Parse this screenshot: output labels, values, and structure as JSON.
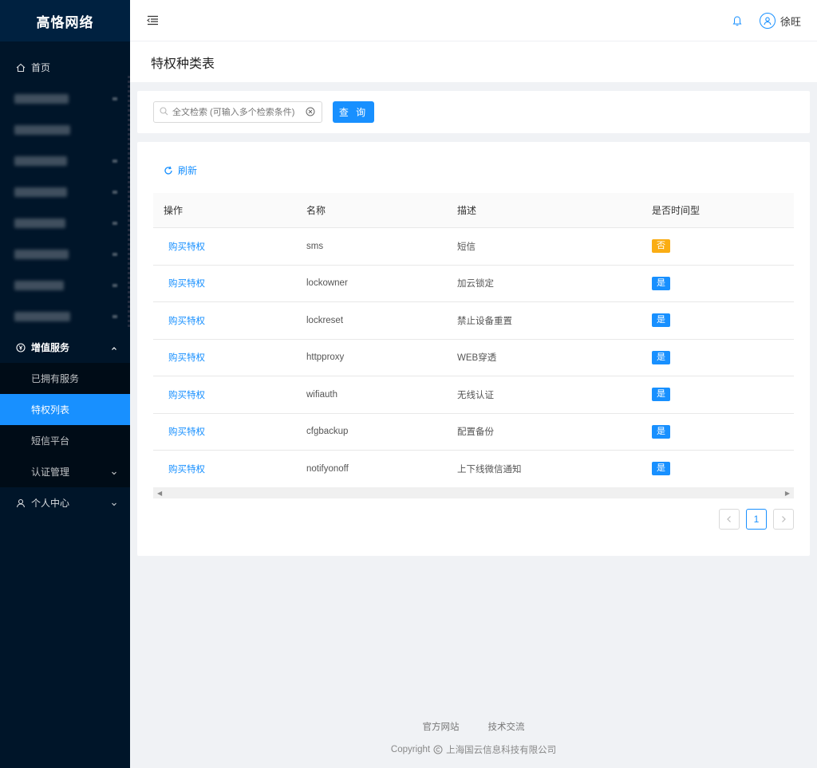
{
  "sidebar": {
    "brand": "高恪网络",
    "home": "首页",
    "value_added": "增值服务",
    "sub_items": {
      "owned": "已拥有服务",
      "privilege_list": "特权列表",
      "sms_platform": "短信平台",
      "auth_mgmt": "认证管理"
    },
    "personal": "个人中心"
  },
  "header": {
    "username": "徐旺"
  },
  "page": {
    "title": "特权种类表"
  },
  "search": {
    "placeholder": "全文检索 (可输入多个检索条件)",
    "button": "查 询"
  },
  "table": {
    "refresh": "刷新",
    "columns": [
      "操作",
      "名称",
      "描述",
      "是否时间型"
    ],
    "rows": [
      {
        "action": "购买特权",
        "name": "sms",
        "desc": "短信",
        "timed": "否"
      },
      {
        "action": "购买特权",
        "name": "lockowner",
        "desc": "加云锁定",
        "timed": "是"
      },
      {
        "action": "购买特权",
        "name": "lockreset",
        "desc": "禁止设备重置",
        "timed": "是"
      },
      {
        "action": "购买特权",
        "name": "httpproxy",
        "desc": "WEB穿透",
        "timed": "是"
      },
      {
        "action": "购买特权",
        "name": "wifiauth",
        "desc": "无线认证",
        "timed": "是"
      },
      {
        "action": "购买特权",
        "name": "cfgbackup",
        "desc": "配置备份",
        "timed": "是"
      },
      {
        "action": "购买特权",
        "name": "notifyonoff",
        "desc": "上下线微信通知",
        "timed": "是"
      }
    ]
  },
  "pagination": {
    "current": "1"
  },
  "footer": {
    "link1": "官方网站",
    "link2": "技术交流",
    "copyright_prefix": "Copyright",
    "company": "上海国云信息科技有限公司"
  },
  "colors": {
    "primary": "#1890ff",
    "warning": "#faad14",
    "sidebar_bg": "#001529"
  }
}
